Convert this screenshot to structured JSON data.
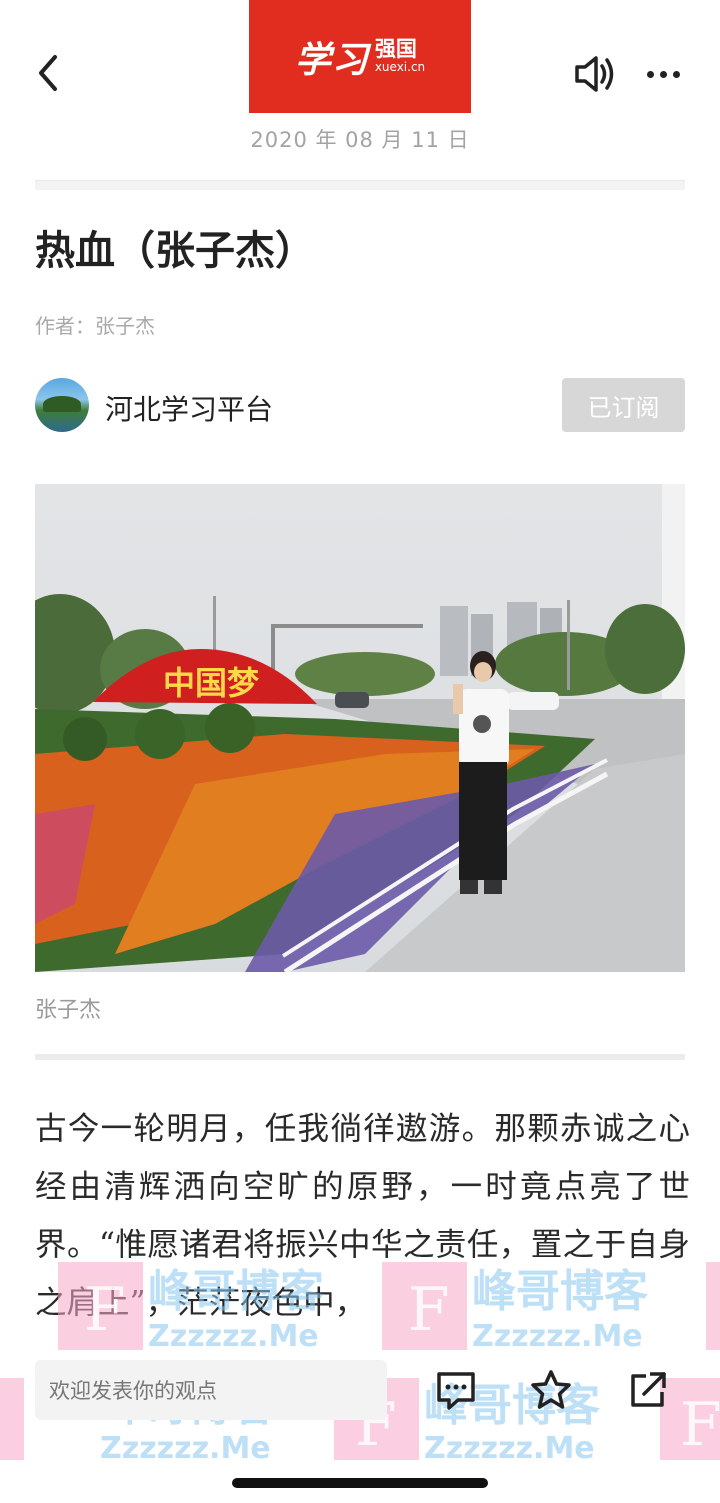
{
  "header": {
    "logo_main": "学习",
    "logo_side_cn": "强国",
    "logo_side_en": "xuexi.cn",
    "date": "2020 年 08 月 11 日",
    "icons": {
      "back": "back-arrow-icon",
      "speaker": "speaker-icon",
      "more": "more-dots-icon"
    }
  },
  "article": {
    "title": "热血（张子杰）",
    "author": "作者：张子杰",
    "channel_name": "河北学习平台",
    "subscribe_label": "已订阅",
    "photo_caption": "张子杰",
    "photo_sign_text": "中国梦",
    "body": "古今一轮明月，任我徜徉遨游。那颗赤诚之心经由清辉洒向空旷的原野，一时竟点亮了世界。“惟愿诸君将振兴中华之责任，置之于自身之肩上”，茫茫夜色中，"
  },
  "watermark": {
    "brand": "峰哥博客",
    "site": "Zzzzzz.Me",
    "letter": "F"
  },
  "bottom_bar": {
    "comment_placeholder": "欢迎发表你的观点",
    "icons": [
      "comment-icon",
      "star-icon",
      "share-icon"
    ]
  },
  "colors": {
    "logo_red": "#e02d1f",
    "subscribed_gray": "#d7d7d7",
    "watermark_pink": "#f7a8c8",
    "watermark_blue": "#88c8ef"
  }
}
